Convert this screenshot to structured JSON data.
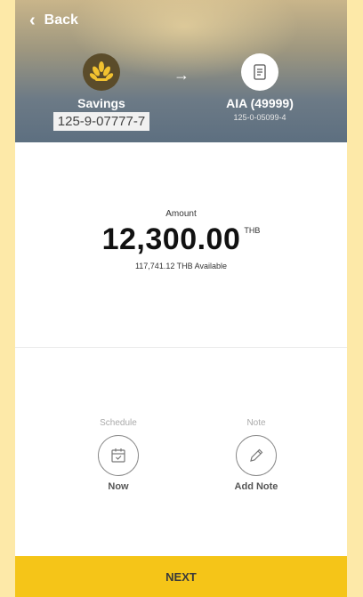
{
  "header": {
    "back_label": "Back",
    "from_account": {
      "name": "Savings",
      "number": "125-9-07777-7",
      "icon": "bank-logo-icon"
    },
    "to_account": {
      "name": "AIA (49999)",
      "number": "125-0-05099-4",
      "icon": "bill-icon"
    },
    "arrow": "→"
  },
  "amount": {
    "label": "Amount",
    "value": "12,300.00",
    "currency": "THB",
    "available": "117,741.12 THB Available"
  },
  "options": {
    "schedule": {
      "label": "Schedule",
      "value": "Now",
      "icon": "calendar-icon"
    },
    "note": {
      "label": "Note",
      "value": "Add Note",
      "icon": "pencil-icon"
    }
  },
  "next_label": "NEXT",
  "colors": {
    "accent": "#f5c518",
    "background": "#fde9a8"
  }
}
